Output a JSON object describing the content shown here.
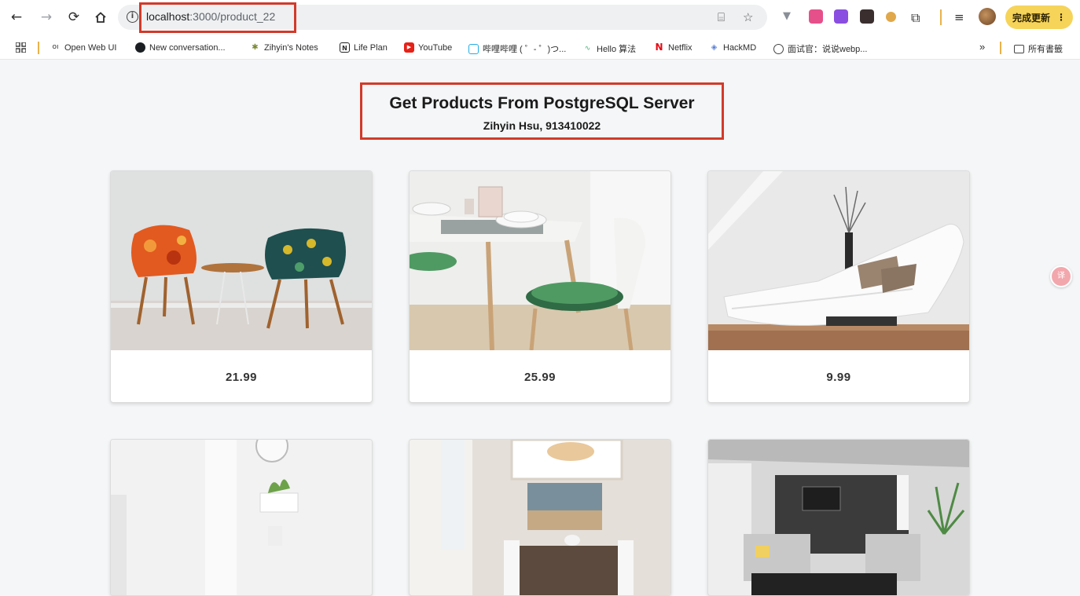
{
  "browser": {
    "url_host": "localhost",
    "url_path": ":3000/product_22",
    "update_label": "完成更新",
    "update_menu": "⋮"
  },
  "bookmarks": [
    {
      "label": "Open Web UI",
      "icon": "openwebui-icon"
    },
    {
      "label": "New conversation...",
      "icon": "github-icon"
    },
    {
      "label": "Zihyin's Notes",
      "icon": "notes-icon"
    },
    {
      "label": "Life Plan",
      "icon": "notion-icon"
    },
    {
      "label": "YouTube",
      "icon": "youtube-icon"
    },
    {
      "label": "哔哩哔哩 ( ゜- ゜)つ...",
      "icon": "bilibili-icon"
    },
    {
      "label": "Hello 算法",
      "icon": "hello-algo-icon"
    },
    {
      "label": "Netflix",
      "icon": "netflix-icon"
    },
    {
      "label": "HackMD",
      "icon": "hackmd-icon"
    },
    {
      "label": "面试官：说说webp...",
      "icon": "globe-icon"
    }
  ],
  "bookmarks_more": "»",
  "all_bookmarks": "所有書籤",
  "page": {
    "title": "Get Products From PostgreSQL Server",
    "subtitle": "Zihyin Hsu, 913410022"
  },
  "products": [
    {
      "price": "21.99",
      "image": "two patterned armchairs with side table"
    },
    {
      "price": "25.99",
      "image": "dining table with plates and green cushion chair"
    },
    {
      "price": "9.99",
      "image": "white chaise lounge with pillows"
    },
    {
      "price": "",
      "image": "white room with plant shelf"
    },
    {
      "price": "",
      "image": "dining room with pendant light"
    },
    {
      "price": "",
      "image": "modern living room with tv wall"
    }
  ],
  "colors": {
    "highlight": "#d23a2a",
    "update_button": "#f6d45a",
    "page_bg": "#f4f6f7"
  }
}
